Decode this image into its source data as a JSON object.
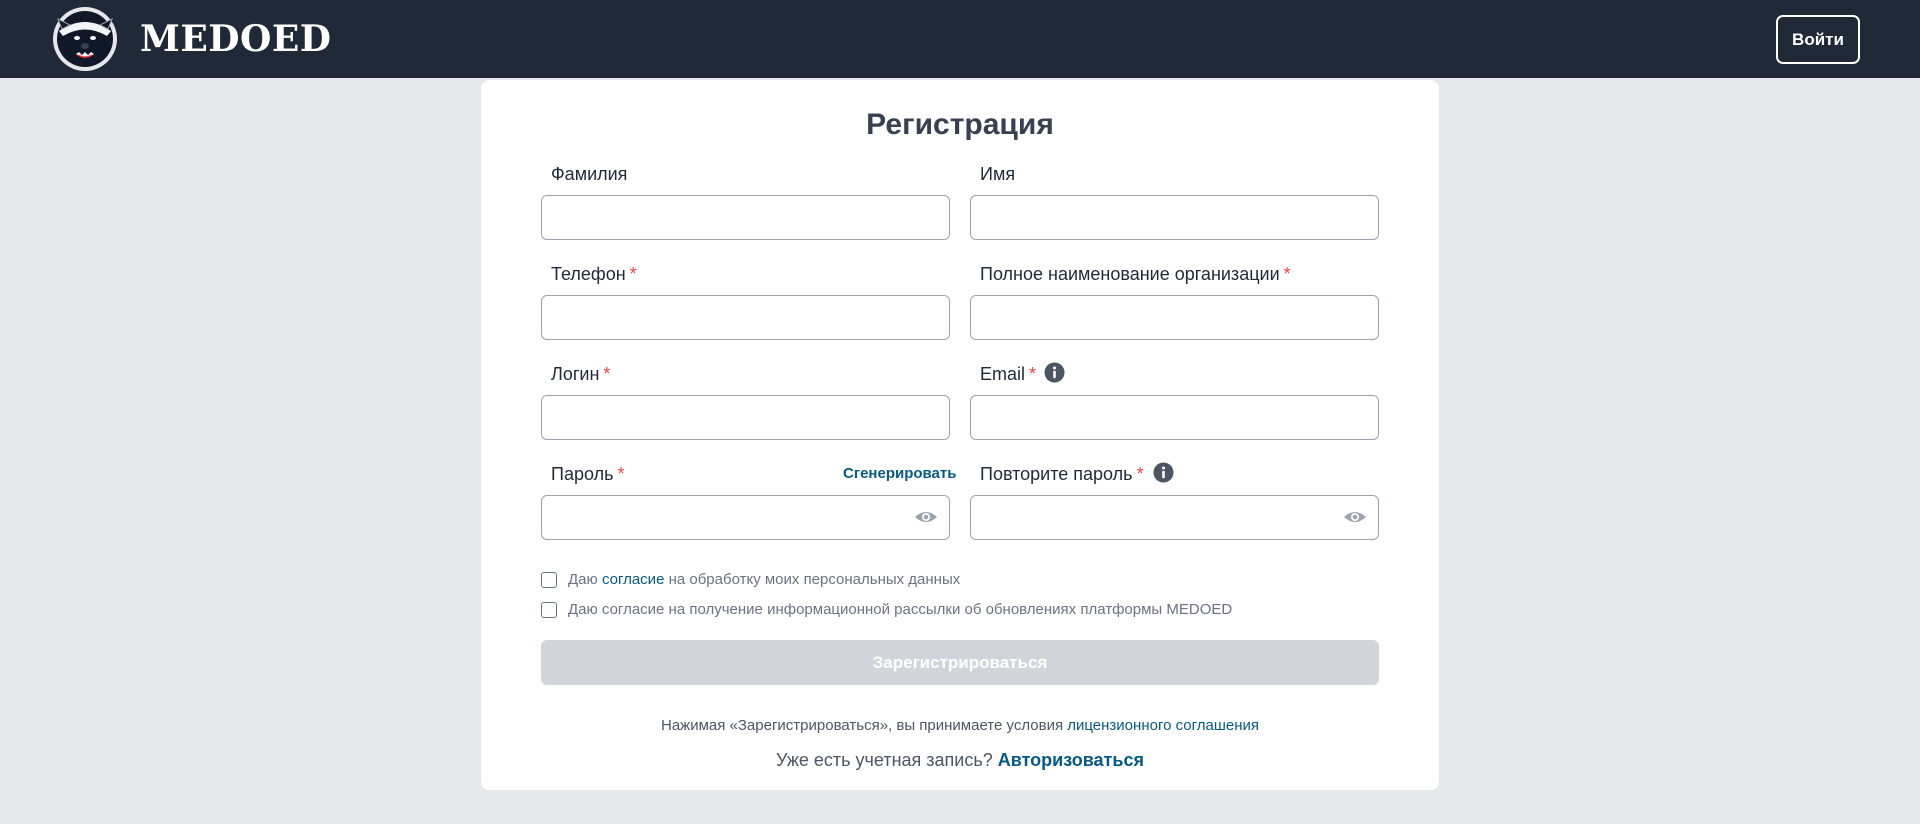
{
  "header": {
    "brand": "MEDOED",
    "login_label": "Войти",
    "background": "#1f2937"
  },
  "form": {
    "title": "Регистрация",
    "required_mark": "*",
    "last_name": {
      "label": "Фамилия",
      "value": ""
    },
    "first_name": {
      "label": "Имя",
      "value": ""
    },
    "phone": {
      "label": "Телефон",
      "required": true,
      "value": ""
    },
    "organization": {
      "label": "Полное наименование организации",
      "required": true,
      "value": ""
    },
    "login": {
      "label": "Логин",
      "required": true,
      "value": ""
    },
    "email": {
      "label": "Email",
      "required": true,
      "value": ""
    },
    "password": {
      "label": "Пароль",
      "required": true,
      "value": "",
      "generate_label": "Сгенерировать"
    },
    "password_repeat": {
      "label": "Повторите пароль",
      "required": true,
      "value": ""
    },
    "consent_personal": {
      "prefix": "Даю",
      "link": "согласие",
      "suffix": "на обработку моих персональных данных",
      "checked": false
    },
    "consent_newsletter": {
      "text": "Даю согласие на получение информационной рассылки об обновлениях платформы MEDOED",
      "checked": false
    },
    "submit_label": "Зарегистрироваться",
    "terms_text": "Нажимая «Зарегистрироваться», вы принимаете условия",
    "terms_link": "лицензионного соглашения",
    "have_account_text": "Уже есть учетная запись?",
    "login_link": "Авторизоваться"
  },
  "icons": {
    "logo": "honey-badger-logo",
    "info": "info-icon",
    "eye": "eye-icon"
  },
  "colors": {
    "page_background": "#e5e7eb",
    "accent_link": "#075985",
    "required": "#ef4444",
    "submit_disabled": "#d1d5db"
  }
}
